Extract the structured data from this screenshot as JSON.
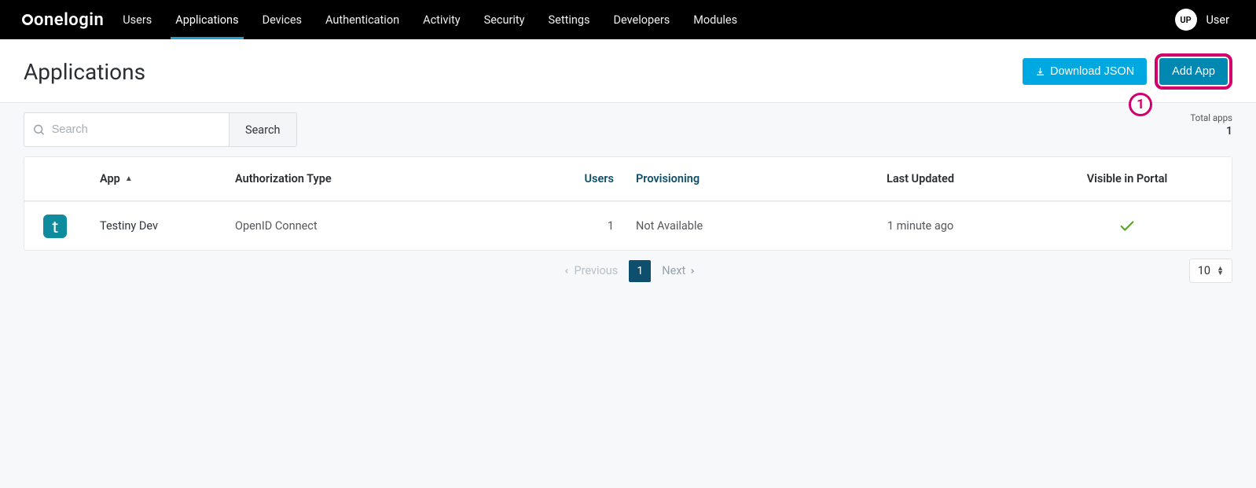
{
  "brand": "onelogin",
  "nav": {
    "items": [
      "Users",
      "Applications",
      "Devices",
      "Authentication",
      "Activity",
      "Security",
      "Settings",
      "Developers",
      "Modules"
    ],
    "active_index": 1
  },
  "user": {
    "initials": "UP",
    "label": "User"
  },
  "page": {
    "title": "Applications"
  },
  "header_actions": {
    "download_label": "Download JSON",
    "add_label": "Add App",
    "callout_number": "1"
  },
  "search": {
    "placeholder": "Search",
    "button_label": "Search"
  },
  "totals": {
    "label": "Total apps",
    "count": "1"
  },
  "table": {
    "columns": {
      "app": "App",
      "auth": "Authorization Type",
      "users": "Users",
      "provisioning": "Provisioning",
      "last_updated": "Last Updated",
      "visible": "Visible in Portal"
    },
    "rows": [
      {
        "icon_letter": "ʈ",
        "name": "Testiny Dev",
        "auth": "OpenID Connect",
        "users": "1",
        "provisioning": "Not Available",
        "last_updated": "1 minute ago",
        "visible": true
      }
    ]
  },
  "pagination": {
    "previous": "Previous",
    "next": "Next",
    "current": "1",
    "page_size": "10"
  }
}
